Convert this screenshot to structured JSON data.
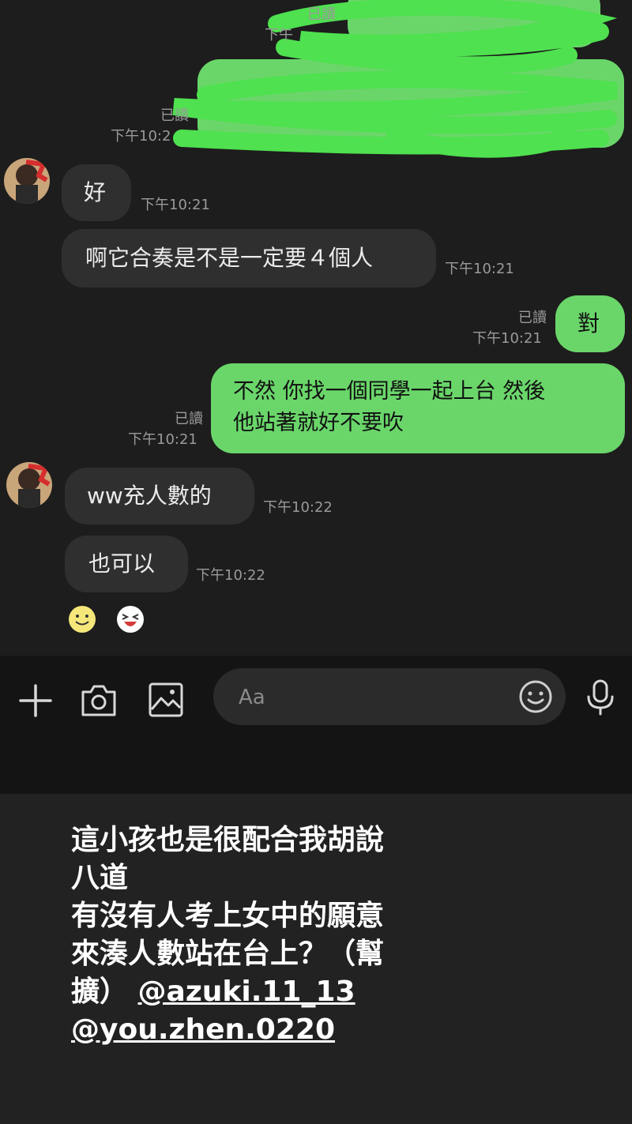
{
  "chat": {
    "top": {
      "read_1": "已讀",
      "time_1": "下午",
      "read_2": "已讀",
      "time_2": "下午10:2"
    },
    "messages": [
      {
        "id": "m1",
        "text": "好",
        "time": "下午10:21"
      },
      {
        "id": "m2",
        "text": "啊它合奏是不是一定要４個人",
        "time": "下午10:21"
      },
      {
        "id": "m3",
        "text": "對",
        "read": "已讀",
        "time": "下午10:21"
      },
      {
        "id": "m4",
        "line1": "不然 你找一個同學一起上台 然後",
        "line2": "他站著就好不要吹",
        "read": "已讀",
        "time": "下午10:21"
      },
      {
        "id": "m5",
        "text": "ww充人數的",
        "time": "下午10:22"
      },
      {
        "id": "m6",
        "text": "也可以",
        "time": "下午10:22"
      }
    ]
  },
  "input": {
    "placeholder": "Aa"
  },
  "icons": {
    "add": "plus-icon",
    "camera": "camera-icon",
    "gallery": "image-icon",
    "emoji": "smiley-icon",
    "mic": "microphone-icon"
  },
  "caption": {
    "line1": "這小孩也是很配合我胡說",
    "line2": "八道",
    "line3": "有沒有人考上女中的願意",
    "line4": "來湊人數站在台上？（幫",
    "line5_prefix": "擴） ",
    "mention1": "@azuki.11_13",
    "mention2": "@you.zhen.0220"
  },
  "colors": {
    "chat_background": "#1d1d1d",
    "incoming_bubble": "#2f2f2f",
    "outgoing_bubble": "#6ad66a",
    "scribble": "#4fe14f",
    "caption_background": "#222222"
  }
}
